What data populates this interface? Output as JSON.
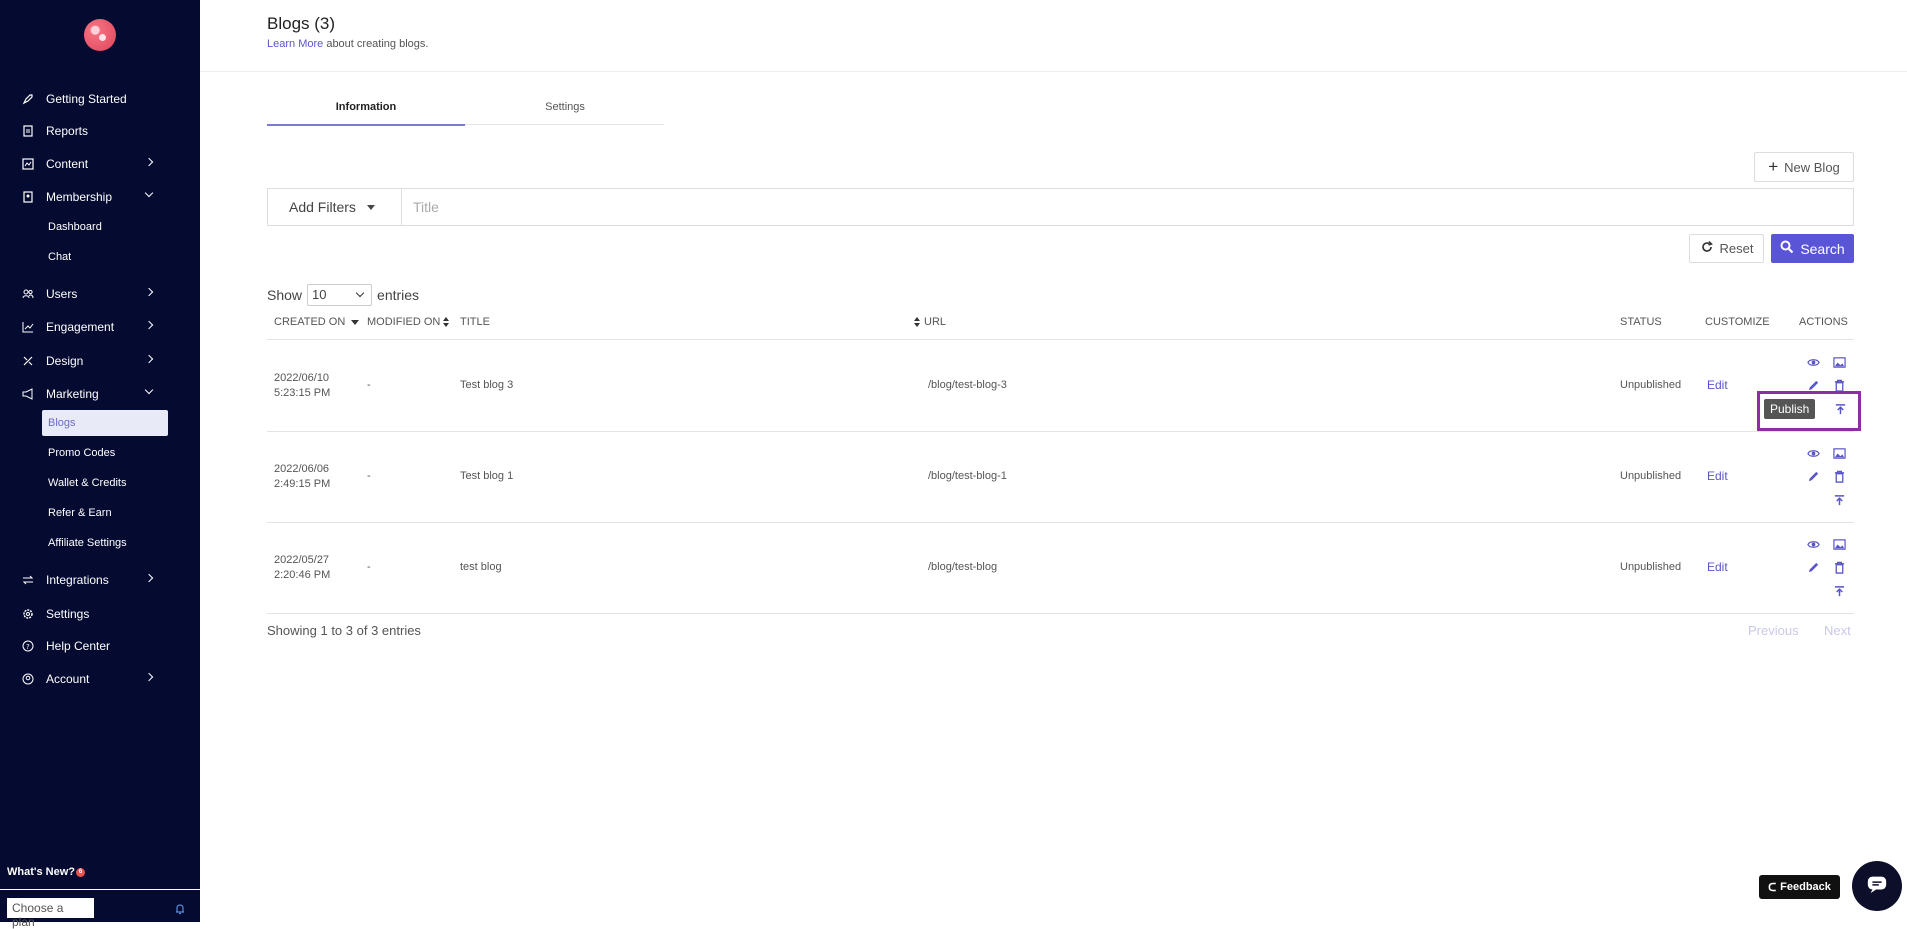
{
  "sidebar": {
    "items": [
      {
        "label": "Getting Started",
        "icon": "rocket-icon"
      },
      {
        "label": "Reports",
        "icon": "report-icon"
      },
      {
        "label": "Content",
        "icon": "content-icon"
      },
      {
        "label": "Membership",
        "icon": "membership-icon"
      },
      {
        "label": "Users",
        "icon": "users-icon"
      },
      {
        "label": "Engagement",
        "icon": "engagement-icon"
      },
      {
        "label": "Design",
        "icon": "design-icon"
      },
      {
        "label": "Marketing",
        "icon": "megaphone-icon"
      },
      {
        "label": "Integrations",
        "icon": "integrations-icon"
      },
      {
        "label": "Settings",
        "icon": "gear-icon"
      },
      {
        "label": "Help Center",
        "icon": "help-icon"
      },
      {
        "label": "Account",
        "icon": "account-icon"
      }
    ],
    "membership_sub": [
      "Dashboard",
      "Chat"
    ],
    "marketing_sub": [
      "Blogs",
      "Promo Codes",
      "Wallet & Credits",
      "Refer & Earn",
      "Affiliate Settings"
    ],
    "whats_new": "What's New?",
    "whats_new_count": "6",
    "plan_select": "Choose a plan"
  },
  "header": {
    "title": "Blogs (3)",
    "learn_more": "Learn More",
    "learn_suffix": " about creating blogs."
  },
  "tabs": [
    "Information",
    "Settings"
  ],
  "toolbar": {
    "new_blog": "New Blog",
    "add_filters": "Add Filters",
    "title_placeholder": "Title",
    "reset": "Reset",
    "search": "Search"
  },
  "entries": {
    "show": "Show",
    "value": "10",
    "suffix": "entries"
  },
  "table": {
    "columns": [
      "CREATED ON",
      "MODIFIED ON",
      "TITLE",
      "URL",
      "STATUS",
      "CUSTOMIZE",
      "ACTIONS"
    ],
    "rows": [
      {
        "created_date": "2022/06/10",
        "created_time": "5:23:15 PM",
        "modified": "-",
        "title": "Test blog 3",
        "url": "/blog/test-blog-3",
        "status": "Unpublished",
        "customize": "Edit"
      },
      {
        "created_date": "2022/06/06",
        "created_time": "2:49:15 PM",
        "modified": "-",
        "title": "Test blog 1",
        "url": "/blog/test-blog-1",
        "status": "Unpublished",
        "customize": "Edit"
      },
      {
        "created_date": "2022/05/27",
        "created_time": "2:20:46 PM",
        "modified": "-",
        "title": "test blog",
        "url": "/blog/test-blog",
        "status": "Unpublished",
        "customize": "Edit"
      }
    ]
  },
  "footer": {
    "showing": "Showing 1 to 3 of 3 entries",
    "previous": "Previous",
    "next": "Next"
  },
  "tooltip": "Publish",
  "feedback": "Feedback",
  "colors": {
    "sidebar_bg": "#050a30",
    "accent": "#5a55d6",
    "highlight": "#8a2ea3"
  }
}
